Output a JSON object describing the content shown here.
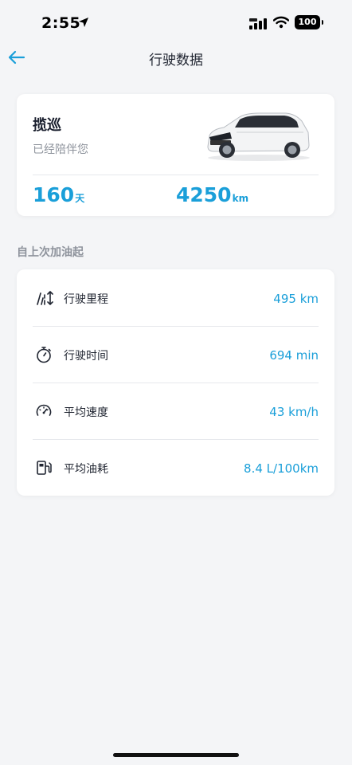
{
  "status_bar": {
    "time": "2:55",
    "battery": "100",
    "icons": [
      "location-arrow-icon",
      "signal-icon",
      "wifi-icon",
      "battery-icon"
    ]
  },
  "nav": {
    "back_icon": "arrow-left-icon",
    "title": "行驶数据"
  },
  "car": {
    "name": "揽巡",
    "subtitle": "已经陪伴您",
    "days_value": "160",
    "days_unit": "天",
    "mileage_value": "4250",
    "mileage_unit": "km"
  },
  "section_title": "自上次加油起",
  "stats": [
    {
      "icon": "road-distance-icon",
      "label": "行驶里程",
      "value": "495  km"
    },
    {
      "icon": "stopwatch-icon",
      "label": "行驶时间",
      "value": "694 min"
    },
    {
      "icon": "speedometer-icon",
      "label": "平均速度",
      "value": "43 km/h"
    },
    {
      "icon": "fuel-pump-icon",
      "label": "平均油耗",
      "value": "8.4 L/100km"
    }
  ],
  "colors": {
    "accent": "#1a9fd9",
    "background": "#f4f5f7",
    "card": "#ffffff",
    "muted": "#8e939c"
  }
}
